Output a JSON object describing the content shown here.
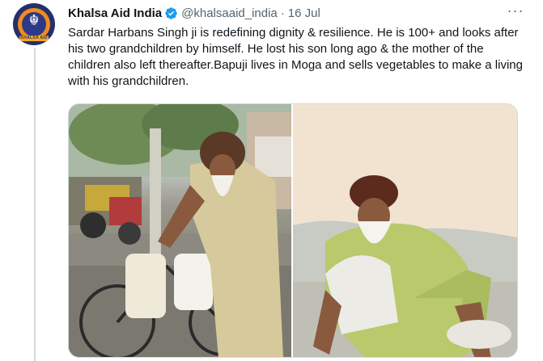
{
  "tweet": {
    "display_name": "Khalsa Aid India",
    "handle": "@khalsaaid_india",
    "separator": "·",
    "date": "16 Jul",
    "more_label": "···",
    "verified": true,
    "avatar_text": "KHALSA AID",
    "text": "Sardar Harbans Singh ji is redefining dignity & resilience. He is 100+ and looks after his two grandchildren by himself. He lost his son long ago & the mother of the children also left thereafter.Bapuji lives in Moga and sells vegetables to make a living with his grandchildren."
  },
  "media": {
    "photos": [
      {
        "name": "photo-pushing-bicycle"
      },
      {
        "name": "photo-seated-portrait"
      }
    ]
  },
  "colors": {
    "text_primary": "#0f1419",
    "text_secondary": "#536471",
    "verified_blue": "#1d9bf0",
    "border": "#cfd9de",
    "avatar_navy": "#24306b",
    "avatar_orange": "#f28a1e"
  }
}
